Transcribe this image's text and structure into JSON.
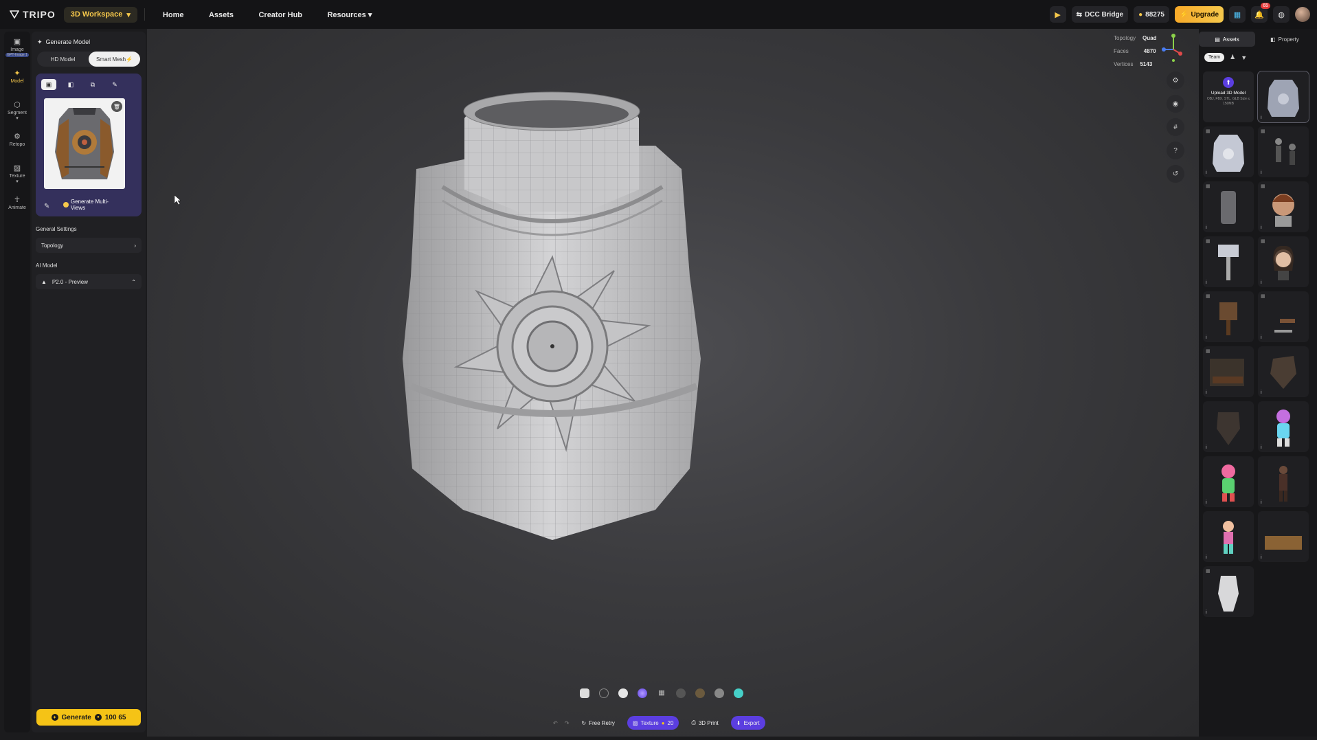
{
  "topbar": {
    "logo": "TRIPO",
    "workspace": "3D Workspace",
    "nav": [
      "Home",
      "Assets",
      "Creator Hub",
      "Resources"
    ],
    "dcc_bridge": "DCC Bridge",
    "credits": "88275",
    "upgrade": "Upgrade",
    "notif_count": "65"
  },
  "left_rail": {
    "items": [
      {
        "label": "Image",
        "sub": "GPT-Image 1"
      },
      {
        "label": "Model"
      },
      {
        "label": "Segment"
      },
      {
        "label": "Retopo"
      },
      {
        "label": "Texture"
      },
      {
        "label": "Animate"
      }
    ]
  },
  "panel": {
    "title": "Generate Model",
    "modes": [
      "HD Model",
      "Smart Mesh"
    ],
    "generate_multiviews": "Generate Multi-Views",
    "general_settings": "General Settings",
    "topology": "Topology",
    "ai_model_title": "AI Model",
    "ai_model": "P2.0 - Preview",
    "generate_label": "Generate",
    "generate_cost": "100 65"
  },
  "viewport": {
    "stats": [
      {
        "label": "Topology",
        "value": "Quad"
      },
      {
        "label": "Faces",
        "value": "4870"
      },
      {
        "label": "Vertices",
        "value": "5143"
      }
    ],
    "actions": {
      "free_retry": "Free Retry",
      "texture": "Texture",
      "texture_cost": "20",
      "print": "3D Print",
      "export": "Export"
    }
  },
  "right_panel": {
    "tabs": [
      "Assets",
      "Property"
    ],
    "filter": "Team",
    "upload_title": "Upload 3D Model",
    "upload_sub": "OBJ, FBX, STL, GLB Size ≤ 150MB"
  },
  "colors": {
    "accent": "#f5c316",
    "purple": "#5b3ee0"
  }
}
